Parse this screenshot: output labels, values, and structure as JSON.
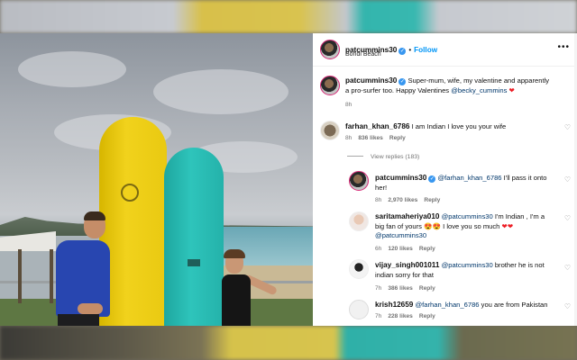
{
  "post": {
    "author": "patcummins30",
    "follow_label": "Follow",
    "dot": "•",
    "location": "Bondi Beach",
    "caption_line1": "Super-mum, wife, my valentine and apparently",
    "caption_line2a": "a pro-surfer too. Happy Valentines",
    "caption_mention": "@becky_cummins",
    "caption_heart": "❤",
    "time": "8h"
  },
  "comments": [
    {
      "user": "farhan_khan_6786",
      "text": "I am Indian I love you your wife",
      "time": "8h",
      "likes": "836 likes",
      "reply": "Reply"
    }
  ],
  "view_replies": "View replies (183)",
  "replies": [
    {
      "user": "patcummins30",
      "mention": "@farhan_khan_6786",
      "text1": "I'll pass it onto",
      "text2": "her!",
      "time": "8h",
      "likes": "2,970 likes",
      "reply": "Reply"
    },
    {
      "user": "saritamaheriya010",
      "mention": "@patcummins30",
      "text1": "I'm Indian , I'm a",
      "text2a": "big fan of yours",
      "emoji": "😍😍",
      "text2b": "I love you so much",
      "text2c": "❤❤",
      "mention2": "@patcummins30",
      "time": "6h",
      "likes": "120 likes",
      "reply": "Reply"
    },
    {
      "user": "vijay_singh001011",
      "mention": "@patcummins30",
      "text1": "brother he is not",
      "text2": "indian sorry for that",
      "time": "7h",
      "likes": "386 likes",
      "reply": "Reply"
    },
    {
      "user": "krish12659",
      "mention": "@farhan_khan_6786",
      "text1": "you are from Pakistan",
      "time": "7h",
      "likes": "228 likes",
      "reply": "Reply"
    }
  ],
  "icons": {
    "verified": "✓",
    "heart_outline": "♡",
    "more": "•••"
  },
  "colors": {
    "accent": "#0095f6",
    "verified": "#3897f0",
    "mention": "#00376b"
  }
}
